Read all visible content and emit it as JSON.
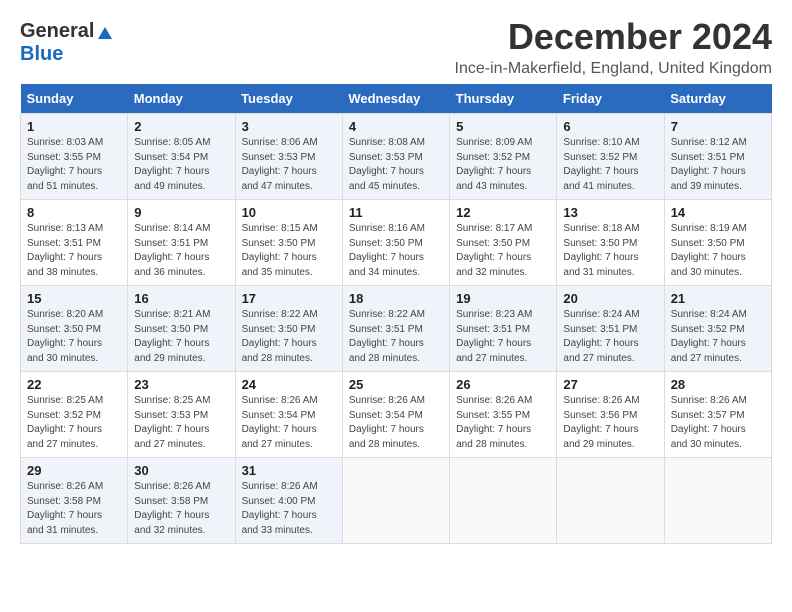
{
  "logo": {
    "general": "General",
    "blue": "Blue"
  },
  "title": "December 2024",
  "location": "Ince-in-Makerfield, England, United Kingdom",
  "days_of_week": [
    "Sunday",
    "Monday",
    "Tuesday",
    "Wednesday",
    "Thursday",
    "Friday",
    "Saturday"
  ],
  "weeks": [
    [
      {
        "day": 1,
        "sunrise": "8:03 AM",
        "sunset": "3:55 PM",
        "daylight": "7 hours and 51 minutes."
      },
      {
        "day": 2,
        "sunrise": "8:05 AM",
        "sunset": "3:54 PM",
        "daylight": "7 hours and 49 minutes."
      },
      {
        "day": 3,
        "sunrise": "8:06 AM",
        "sunset": "3:53 PM",
        "daylight": "7 hours and 47 minutes."
      },
      {
        "day": 4,
        "sunrise": "8:08 AM",
        "sunset": "3:53 PM",
        "daylight": "7 hours and 45 minutes."
      },
      {
        "day": 5,
        "sunrise": "8:09 AM",
        "sunset": "3:52 PM",
        "daylight": "7 hours and 43 minutes."
      },
      {
        "day": 6,
        "sunrise": "8:10 AM",
        "sunset": "3:52 PM",
        "daylight": "7 hours and 41 minutes."
      },
      {
        "day": 7,
        "sunrise": "8:12 AM",
        "sunset": "3:51 PM",
        "daylight": "7 hours and 39 minutes."
      }
    ],
    [
      {
        "day": 8,
        "sunrise": "8:13 AM",
        "sunset": "3:51 PM",
        "daylight": "7 hours and 38 minutes."
      },
      {
        "day": 9,
        "sunrise": "8:14 AM",
        "sunset": "3:51 PM",
        "daylight": "7 hours and 36 minutes."
      },
      {
        "day": 10,
        "sunrise": "8:15 AM",
        "sunset": "3:50 PM",
        "daylight": "7 hours and 35 minutes."
      },
      {
        "day": 11,
        "sunrise": "8:16 AM",
        "sunset": "3:50 PM",
        "daylight": "7 hours and 34 minutes."
      },
      {
        "day": 12,
        "sunrise": "8:17 AM",
        "sunset": "3:50 PM",
        "daylight": "7 hours and 32 minutes."
      },
      {
        "day": 13,
        "sunrise": "8:18 AM",
        "sunset": "3:50 PM",
        "daylight": "7 hours and 31 minutes."
      },
      {
        "day": 14,
        "sunrise": "8:19 AM",
        "sunset": "3:50 PM",
        "daylight": "7 hours and 30 minutes."
      }
    ],
    [
      {
        "day": 15,
        "sunrise": "8:20 AM",
        "sunset": "3:50 PM",
        "daylight": "7 hours and 30 minutes."
      },
      {
        "day": 16,
        "sunrise": "8:21 AM",
        "sunset": "3:50 PM",
        "daylight": "7 hours and 29 minutes."
      },
      {
        "day": 17,
        "sunrise": "8:22 AM",
        "sunset": "3:50 PM",
        "daylight": "7 hours and 28 minutes."
      },
      {
        "day": 18,
        "sunrise": "8:22 AM",
        "sunset": "3:51 PM",
        "daylight": "7 hours and 28 minutes."
      },
      {
        "day": 19,
        "sunrise": "8:23 AM",
        "sunset": "3:51 PM",
        "daylight": "7 hours and 27 minutes."
      },
      {
        "day": 20,
        "sunrise": "8:24 AM",
        "sunset": "3:51 PM",
        "daylight": "7 hours and 27 minutes."
      },
      {
        "day": 21,
        "sunrise": "8:24 AM",
        "sunset": "3:52 PM",
        "daylight": "7 hours and 27 minutes."
      }
    ],
    [
      {
        "day": 22,
        "sunrise": "8:25 AM",
        "sunset": "3:52 PM",
        "daylight": "7 hours and 27 minutes."
      },
      {
        "day": 23,
        "sunrise": "8:25 AM",
        "sunset": "3:53 PM",
        "daylight": "7 hours and 27 minutes."
      },
      {
        "day": 24,
        "sunrise": "8:26 AM",
        "sunset": "3:54 PM",
        "daylight": "7 hours and 27 minutes."
      },
      {
        "day": 25,
        "sunrise": "8:26 AM",
        "sunset": "3:54 PM",
        "daylight": "7 hours and 28 minutes."
      },
      {
        "day": 26,
        "sunrise": "8:26 AM",
        "sunset": "3:55 PM",
        "daylight": "7 hours and 28 minutes."
      },
      {
        "day": 27,
        "sunrise": "8:26 AM",
        "sunset": "3:56 PM",
        "daylight": "7 hours and 29 minutes."
      },
      {
        "day": 28,
        "sunrise": "8:26 AM",
        "sunset": "3:57 PM",
        "daylight": "7 hours and 30 minutes."
      }
    ],
    [
      {
        "day": 29,
        "sunrise": "8:26 AM",
        "sunset": "3:58 PM",
        "daylight": "7 hours and 31 minutes."
      },
      {
        "day": 30,
        "sunrise": "8:26 AM",
        "sunset": "3:58 PM",
        "daylight": "7 hours and 32 minutes."
      },
      {
        "day": 31,
        "sunrise": "8:26 AM",
        "sunset": "4:00 PM",
        "daylight": "7 hours and 33 minutes."
      },
      null,
      null,
      null,
      null
    ]
  ]
}
